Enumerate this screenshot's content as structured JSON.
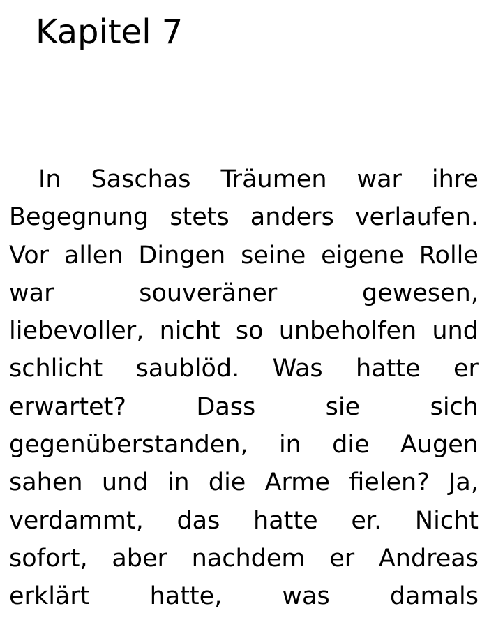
{
  "chapter_title": "Kapitel 7",
  "paragraph_lines": [
    [
      "In",
      "Saschas",
      "Träumen",
      "war",
      "ihre"
    ],
    [
      "Begegnung",
      "stets",
      "anders",
      "verlaufen."
    ],
    [
      "Vor",
      "allen",
      "Dingen",
      "seine",
      "eigene",
      "Rolle"
    ],
    [
      "war",
      "souveräner",
      "gewesen,"
    ],
    [
      "liebevoller,",
      "nicht",
      "so",
      "unbeholfen",
      "und"
    ],
    [
      "schlicht",
      "saublöd.",
      "Was",
      "hatte",
      "er"
    ],
    [
      "erwartet?",
      "Dass",
      "sie",
      "sich"
    ],
    [
      "gegenüberstanden,",
      "in",
      "die",
      "Augen"
    ],
    [
      "sahen",
      "und",
      "in",
      "die",
      "Arme",
      "fielen?",
      "Ja,"
    ],
    [
      "verdammt,",
      "das",
      "hatte",
      "er.",
      "Nicht"
    ],
    [
      "sofort,",
      "aber",
      "nachdem",
      "er",
      "Andreas"
    ],
    [
      "erklärt",
      "hatte,",
      "was",
      "damals"
    ]
  ]
}
